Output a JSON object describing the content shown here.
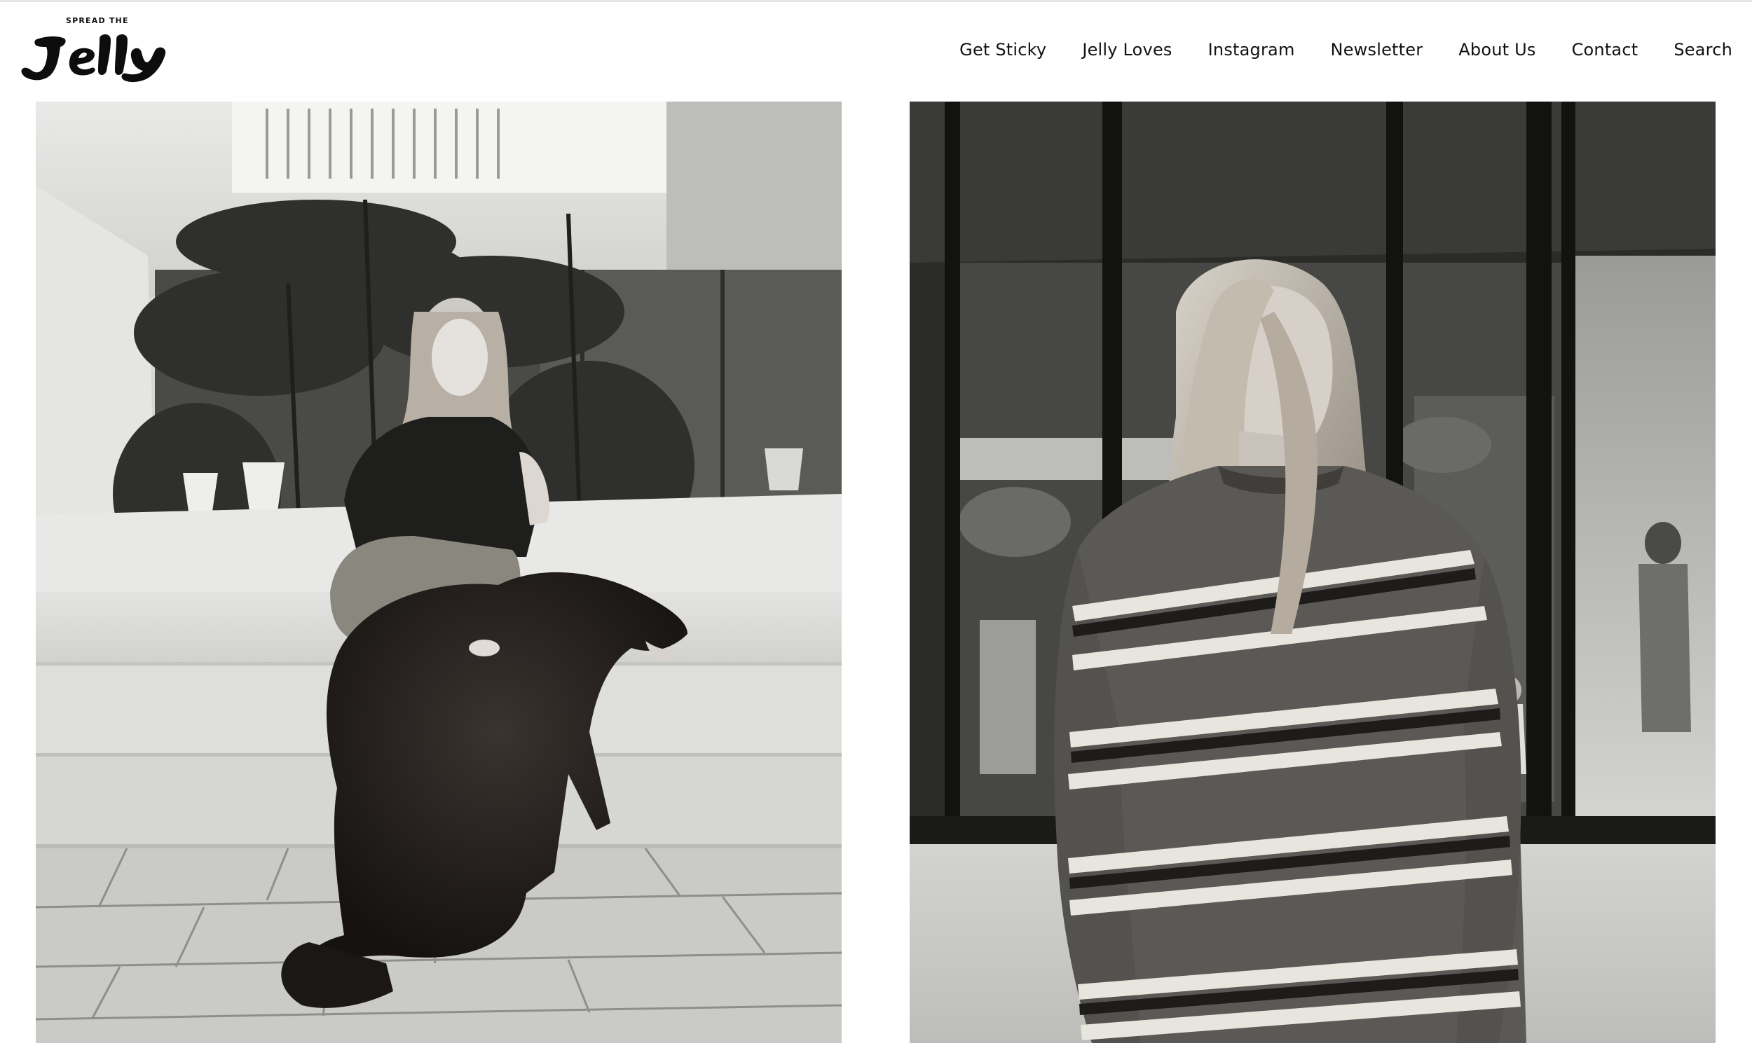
{
  "brand": {
    "tagline": "SPREAD THE",
    "wordmark": "Jelly"
  },
  "nav": {
    "items": [
      {
        "label": "Get Sticky"
      },
      {
        "label": "Jelly Loves"
      },
      {
        "label": "Instagram"
      },
      {
        "label": "Newsletter"
      },
      {
        "label": "About Us"
      },
      {
        "label": "Contact"
      },
      {
        "label": "Search"
      }
    ]
  },
  "gallery": {
    "images": [
      {
        "subject": "Woman in dark sweater seated on steps with a long-haired dog, palm trees behind (black and white)"
      },
      {
        "subject": "Woman in striped crewneck sweater standing before glass doors (black and white)"
      }
    ]
  },
  "colors": {
    "text": "#111111",
    "background": "#ffffff"
  }
}
